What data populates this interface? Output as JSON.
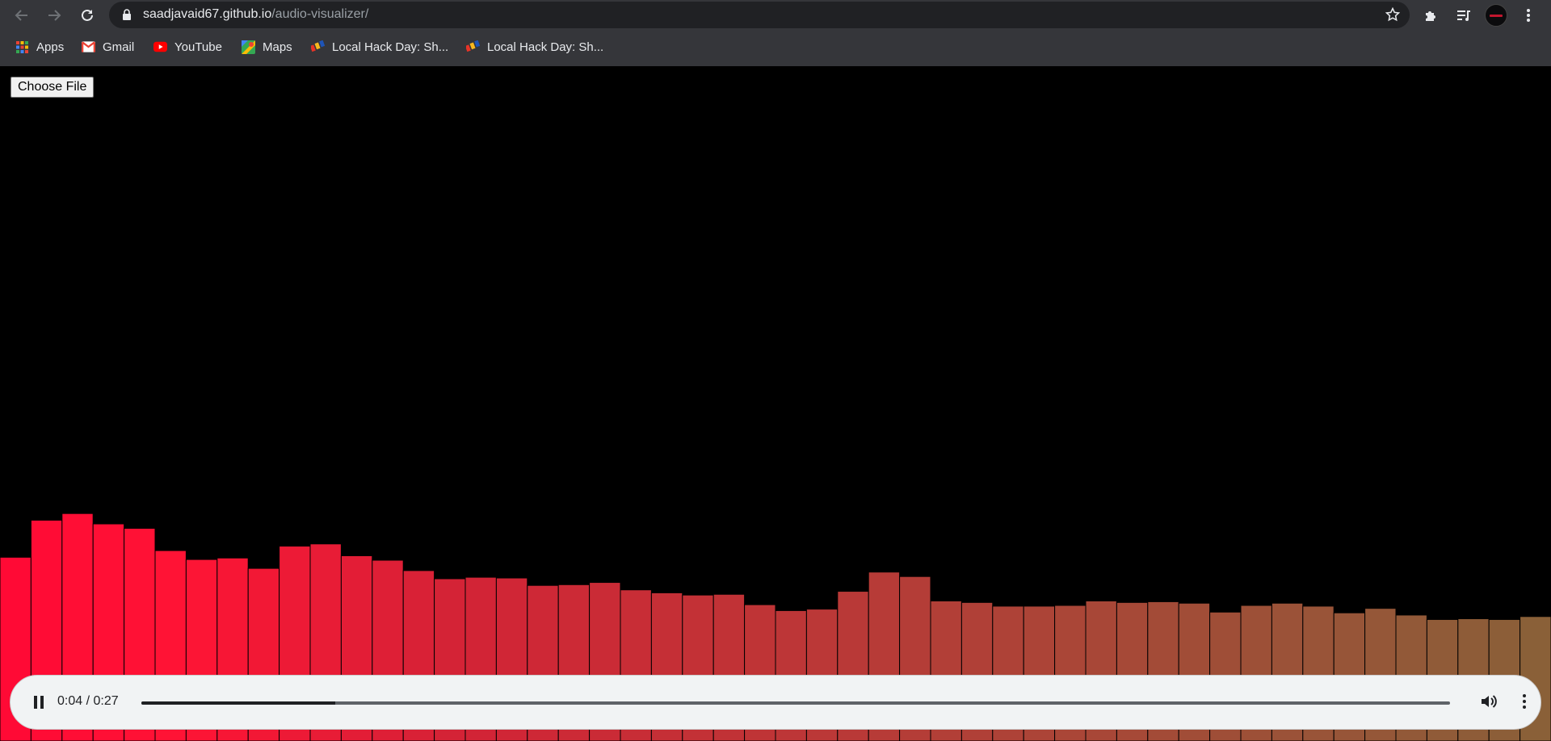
{
  "browser": {
    "url_host": "saadjavaid67.github.io",
    "url_path": "/audio-visualizer/",
    "bookmarks": [
      {
        "label": "Apps",
        "icon": "apps-grid-icon"
      },
      {
        "label": "Gmail",
        "icon": "gmail-icon"
      },
      {
        "label": "YouTube",
        "icon": "youtube-icon"
      },
      {
        "label": "Maps",
        "icon": "maps-icon"
      },
      {
        "label": "Local Hack Day: Sh...",
        "icon": "mlh-icon"
      },
      {
        "label": "Local Hack Day: Sh...",
        "icon": "mlh-icon"
      }
    ]
  },
  "page": {
    "file_button": "Choose File"
  },
  "visualizer": {
    "bar_count": 50,
    "levels": [
      0.248,
      0.298,
      0.307,
      0.293,
      0.287,
      0.257,
      0.245,
      0.247,
      0.233,
      0.263,
      0.266,
      0.25,
      0.244,
      0.23,
      0.219,
      0.221,
      0.22,
      0.21,
      0.211,
      0.214,
      0.204,
      0.2,
      0.197,
      0.198,
      0.184,
      0.176,
      0.178,
      0.202,
      0.228,
      0.222,
      0.189,
      0.187,
      0.182,
      0.182,
      0.183,
      0.189,
      0.187,
      0.188,
      0.186,
      0.174,
      0.183,
      0.186,
      0.182,
      0.173,
      0.179,
      0.17,
      0.164,
      0.165,
      0.164,
      0.168
    ],
    "color_start": "#f20a35",
    "color_end": "#8a6038"
  },
  "player": {
    "state": "playing",
    "current_time": "0:04",
    "duration": "0:27",
    "time_display": "0:04 / 0:27",
    "progress": 0.148
  }
}
